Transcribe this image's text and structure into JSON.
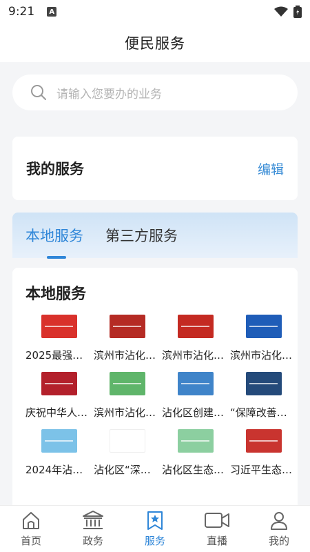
{
  "status_bar": {
    "time": "9:21",
    "notification_letter": "A"
  },
  "header": {
    "title": "便民服务"
  },
  "search": {
    "placeholder": "请输入您要办的业务"
  },
  "my_services": {
    "title": "我的服务",
    "edit_label": "编辑"
  },
  "tabs": [
    {
      "label": "本地服务",
      "active": true
    },
    {
      "label": "第三方服务",
      "active": false
    }
  ],
  "local_services": {
    "title": "本地服务",
    "items": [
      {
        "label": "2025最强…",
        "thumb_color": "#d9312b"
      },
      {
        "label": "滨州市沾化…",
        "thumb_color": "#b52b24"
      },
      {
        "label": "滨州市沾化…",
        "thumb_color": "#c42a22"
      },
      {
        "label": "滨州市沾化…",
        "thumb_color": "#1f5db8"
      },
      {
        "label": "庆祝中华人…",
        "thumb_color": "#b3202b"
      },
      {
        "label": "滨州市沾化…",
        "thumb_color": "#5fb56a"
      },
      {
        "label": "沾化区创建…",
        "thumb_color": "#3f84c9"
      },
      {
        "label": "“保障改善…",
        "thumb_color": "#244a7a"
      },
      {
        "label": "2024年沾…",
        "thumb_color": "#7cc2e8"
      },
      {
        "label": "沾化区“深…",
        "thumb_color": "#ffffff"
      },
      {
        "label": "沾化区生态…",
        "thumb_color": "#8ccfa0"
      },
      {
        "label": "习近平生态…",
        "thumb_color": "#c9342f"
      }
    ]
  },
  "bottom_nav": [
    {
      "label": "首页",
      "icon": "home-icon",
      "active": false
    },
    {
      "label": "政务",
      "icon": "government-building-icon",
      "active": false
    },
    {
      "label": "服务",
      "icon": "service-bookmark-icon",
      "active": true
    },
    {
      "label": "直播",
      "icon": "video-camera-icon",
      "active": false
    },
    {
      "label": "我的",
      "icon": "user-icon",
      "active": false
    }
  ],
  "colors": {
    "accent": "#2f86d8",
    "page_bg": "#f4f5f7"
  }
}
